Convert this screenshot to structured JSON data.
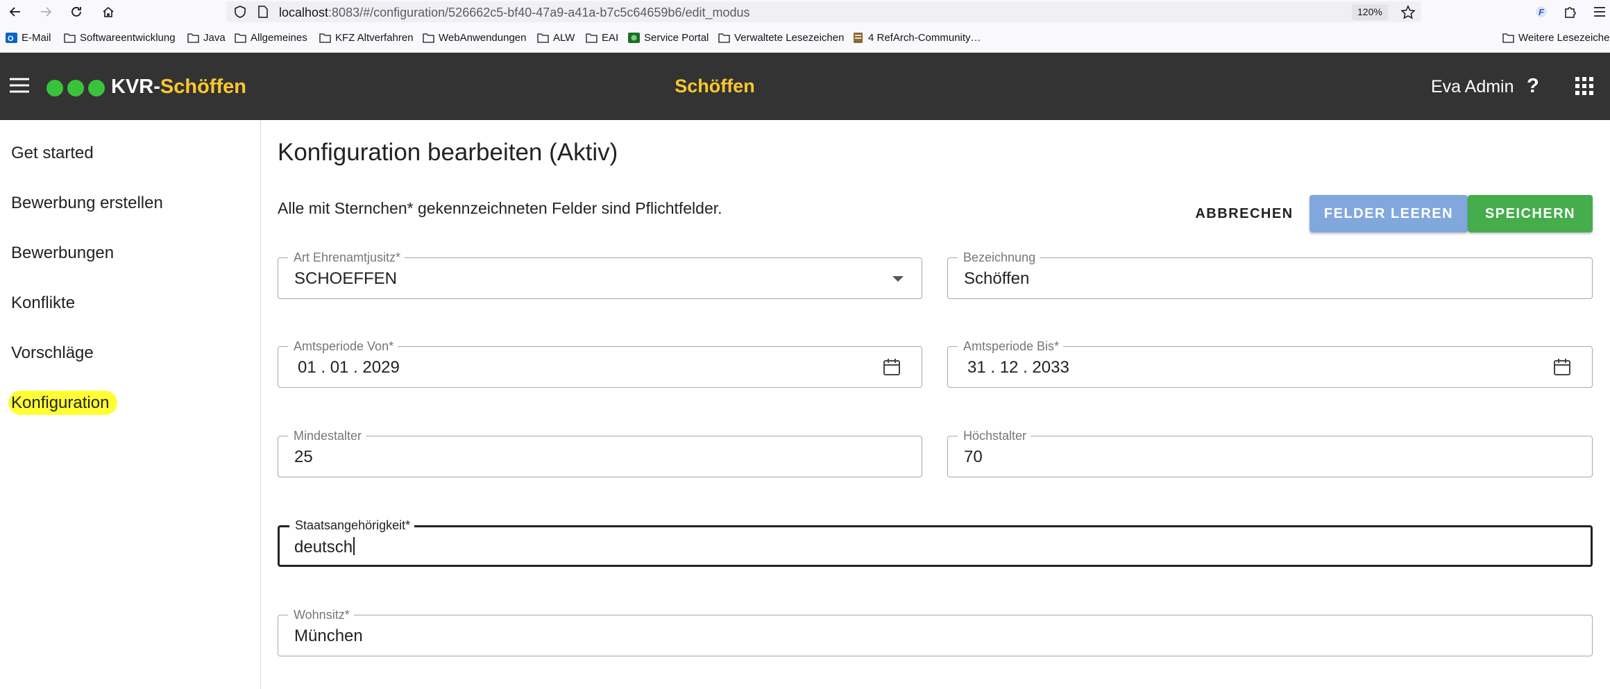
{
  "browser": {
    "url_host": "localhost",
    "url_rest": ":8083/#/configuration/526662c5-bf40-47a9-a41a-b7c5c64659b6/edit_modus",
    "zoom": "120%",
    "bookmarks": [
      {
        "label": "E-Mail",
        "icon": "outlook-icon"
      },
      {
        "label": "Softwareentwicklung",
        "icon": "folder-icon"
      },
      {
        "label": "Java",
        "icon": "folder-icon"
      },
      {
        "label": "Allgemeines",
        "icon": "folder-icon"
      },
      {
        "label": "KFZ Altverfahren",
        "icon": "folder-icon"
      },
      {
        "label": "WebAnwendungen",
        "icon": "folder-icon"
      },
      {
        "label": "ALW",
        "icon": "folder-icon"
      },
      {
        "label": "EAI",
        "icon": "folder-icon"
      },
      {
        "label": "Service Portal",
        "icon": "service-portal-icon"
      },
      {
        "label": "Verwaltete Lesezeichen",
        "icon": "folder-icon"
      },
      {
        "label": "4 RefArch-Community…",
        "icon": "refarch-icon"
      },
      {
        "label": "Weitere Lesezeichen",
        "icon": "folder-icon"
      }
    ]
  },
  "header": {
    "app_name_prefix": "KVR-",
    "app_name_accent": "Schöffen",
    "center_title": "Schöffen",
    "user": "Eva Admin",
    "help": "?"
  },
  "sidebar": {
    "items": [
      {
        "label": "Get started"
      },
      {
        "label": "Bewerbung erstellen"
      },
      {
        "label": "Bewerbungen"
      },
      {
        "label": "Konflikte"
      },
      {
        "label": "Vorschläge"
      },
      {
        "label": "Konfiguration",
        "active": true
      }
    ]
  },
  "main": {
    "title": "Konfiguration bearbeiten (Aktiv)",
    "hint": "Alle mit Sternchen* gekennzeichneten Felder sind Pflichtfelder.",
    "buttons": {
      "cancel": "ABBRECHEN",
      "clear": "FELDER LEEREN",
      "save": "SPEICHERN"
    },
    "fields": {
      "art": {
        "label": "Art Ehrenamtjusitz*",
        "value": "SCHOEFFEN"
      },
      "bezeichnung": {
        "label": "Bezeichnung",
        "value": "Schöffen"
      },
      "von": {
        "label": "Amtsperiode Von*",
        "value": "01 . 01 . 2029"
      },
      "bis": {
        "label": "Amtsperiode Bis*",
        "value": "31 . 12 . 2033"
      },
      "mindestalter": {
        "label": "Mindestalter",
        "value": "25"
      },
      "hoechstalter": {
        "label": "Höchstalter",
        "value": "70"
      },
      "staat": {
        "label": "Staatsangehörigkeit*",
        "value": "deutsch"
      },
      "wohnsitz": {
        "label": "Wohnsitz*",
        "value": "München"
      }
    }
  },
  "colors": {
    "appbar": "#333333",
    "accent_yellow": "#fdc82f",
    "save_green": "#45ad4c",
    "clear_blue": "#81a8dd",
    "highlight": "#ffff33"
  }
}
